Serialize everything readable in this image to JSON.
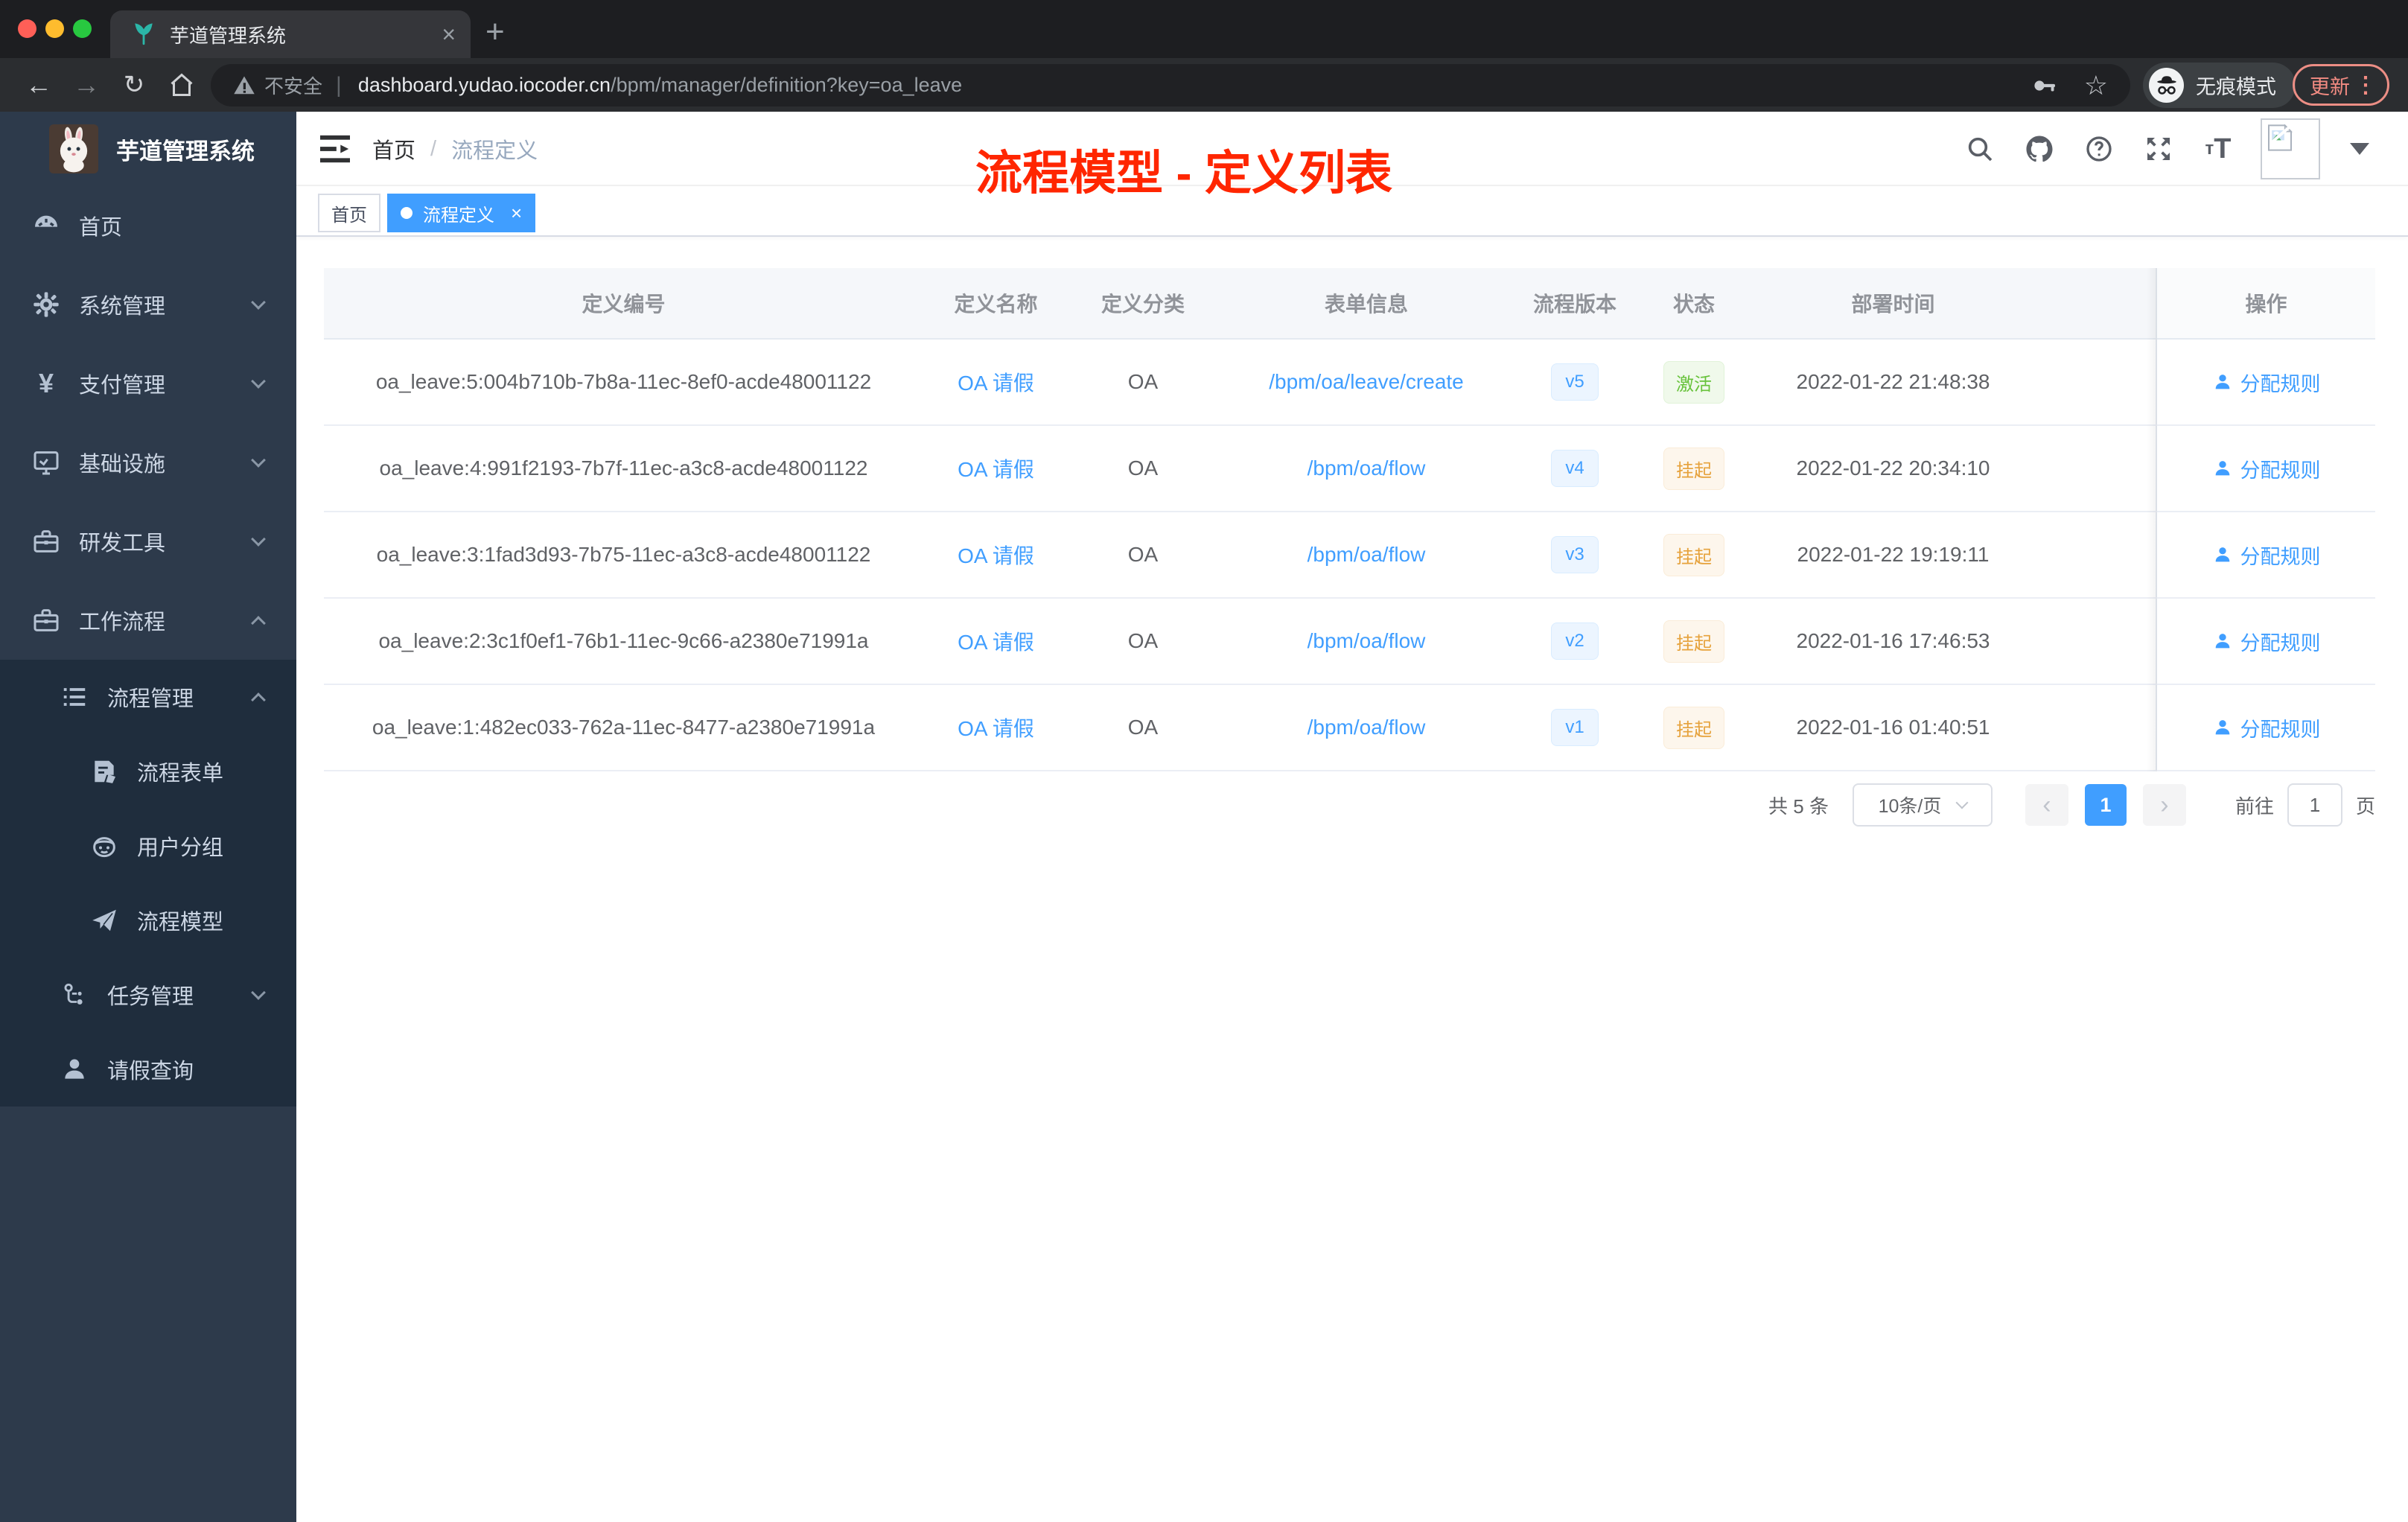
{
  "browser": {
    "tab_title": "芋道管理系统",
    "tab_close_glyph": "×",
    "new_tab_glyph": "+",
    "back_glyph": "←",
    "forward_glyph": "→",
    "reload_glyph": "↻",
    "security_label": "不安全",
    "url_host": "dashboard.yudao.iocoder.cn",
    "url_path": "/bpm/manager/definition?key=oa_leave",
    "star_glyph": "☆",
    "incognito_label": "无痕模式",
    "update_label": "更新",
    "menu_glyph": "⋮"
  },
  "sidebar": {
    "app_title": "芋道管理系统",
    "items": [
      {
        "label": "首页",
        "icon": "dashboard-icon"
      },
      {
        "label": "系统管理",
        "icon": "gear-icon",
        "chevron": "down"
      },
      {
        "label": "支付管理",
        "icon": "yen-icon",
        "chevron": "down",
        "yen_glyph": "¥"
      },
      {
        "label": "基础设施",
        "icon": "monitor-icon",
        "chevron": "down"
      },
      {
        "label": "研发工具",
        "icon": "toolbox-icon",
        "chevron": "down"
      },
      {
        "label": "工作流程",
        "icon": "briefcase-icon",
        "chevron": "up"
      },
      {
        "label": "流程管理",
        "icon": "list-icon",
        "chevron": "up"
      },
      {
        "label": "流程表单",
        "icon": "form-icon"
      },
      {
        "label": "用户分组",
        "icon": "robot-icon"
      },
      {
        "label": "流程模型",
        "icon": "paper-plane-icon"
      },
      {
        "label": "任务管理",
        "icon": "flow-icon",
        "chevron": "down"
      },
      {
        "label": "请假查询",
        "icon": "user-icon"
      }
    ]
  },
  "header": {
    "breadcrumb": {
      "home": "首页",
      "separator": "/",
      "current": "流程定义"
    },
    "annotation": "流程模型 - 定义列表"
  },
  "tags": {
    "inactive": "首页",
    "active": "流程定义",
    "close_glyph": "×"
  },
  "table": {
    "columns": [
      "定义编号",
      "定义名称",
      "定义分类",
      "表单信息",
      "流程版本",
      "状态",
      "部署时间",
      "操作"
    ],
    "rows": [
      {
        "id": "oa_leave:5:004b710b-7b8a-11ec-8ef0-acde48001122",
        "name": "OA 请假",
        "category": "OA",
        "form": "/bpm/oa/leave/create",
        "version": "v5",
        "status": "激活",
        "status_type": "success",
        "time": "2022-01-22 21:48:38",
        "action": "分配规则"
      },
      {
        "id": "oa_leave:4:991f2193-7b7f-11ec-a3c8-acde48001122",
        "name": "OA 请假",
        "category": "OA",
        "form": "/bpm/oa/flow",
        "version": "v4",
        "status": "挂起",
        "status_type": "warning",
        "time": "2022-01-22 20:34:10",
        "action": "分配规则"
      },
      {
        "id": "oa_leave:3:1fad3d93-7b75-11ec-a3c8-acde48001122",
        "name": "OA 请假",
        "category": "OA",
        "form": "/bpm/oa/flow",
        "version": "v3",
        "status": "挂起",
        "status_type": "warning",
        "time": "2022-01-22 19:19:11",
        "action": "分配规则"
      },
      {
        "id": "oa_leave:2:3c1f0ef1-76b1-11ec-9c66-a2380e71991a",
        "name": "OA 请假",
        "category": "OA",
        "form": "/bpm/oa/flow",
        "version": "v2",
        "status": "挂起",
        "status_type": "warning",
        "time": "2022-01-16 17:46:53",
        "action": "分配规则"
      },
      {
        "id": "oa_leave:1:482ec033-762a-11ec-8477-a2380e71991a",
        "name": "OA 请假",
        "category": "OA",
        "form": "/bpm/oa/flow",
        "version": "v1",
        "status": "挂起",
        "status_type": "warning",
        "time": "2022-01-16 01:40:51",
        "action": "分配规则"
      }
    ]
  },
  "pagination": {
    "total": "共 5 条",
    "page_size": "10条/页",
    "prev_glyph": "‹",
    "current_page": "1",
    "next_glyph": "›",
    "goto_label": "前往",
    "goto_value": "1",
    "page_unit": "页"
  },
  "colors": {
    "accent": "#409eff",
    "success": "#67c23a",
    "warning": "#e6a23c",
    "annotation": "#ff2600",
    "sidebar_bg": "#2d3a4b",
    "submenu_bg": "#1f2d3d"
  }
}
